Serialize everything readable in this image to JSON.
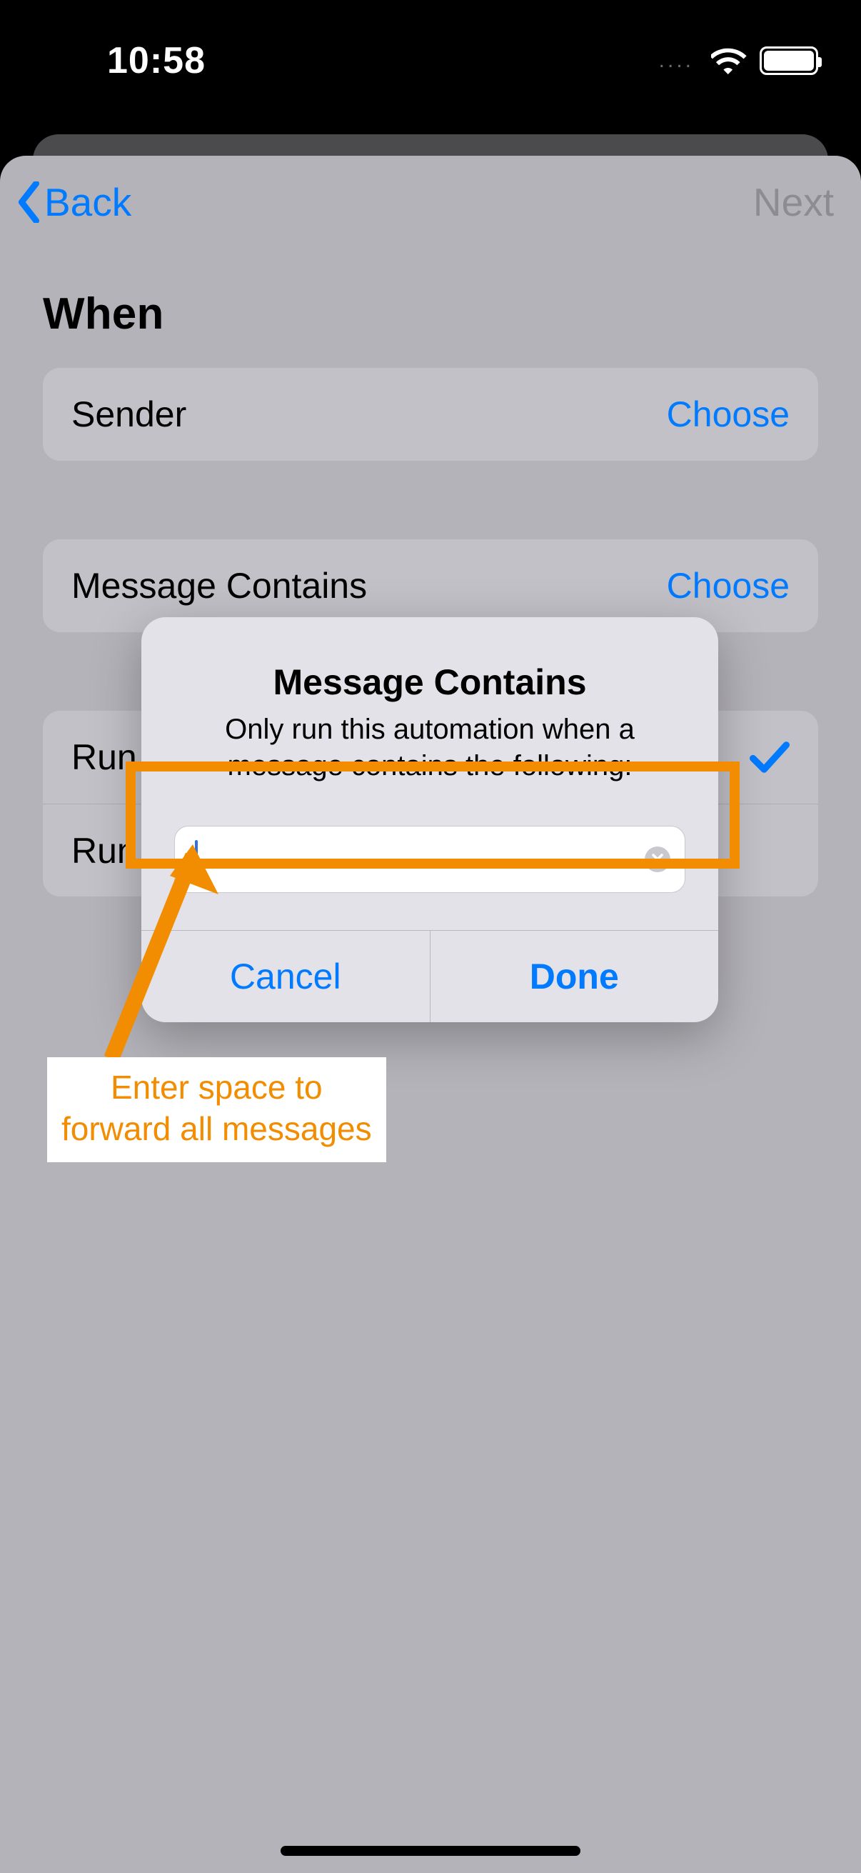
{
  "status": {
    "time": "10:58"
  },
  "nav": {
    "back": "Back",
    "next": "Next"
  },
  "page": {
    "title": "When"
  },
  "rows": {
    "sender": {
      "label": "Sender",
      "action": "Choose"
    },
    "contains": {
      "label": "Message Contains",
      "action": "Choose"
    },
    "confirm": {
      "label": "Run After Confirmation"
    },
    "immediate": {
      "label": "Run Immediately"
    }
  },
  "run_truncated_prefix": "Run",
  "alert": {
    "title": "Message Contains",
    "subtitle": "Only run this automation when a message contains the following:",
    "input_value": "",
    "cancel": "Cancel",
    "done": "Done"
  },
  "annotation": {
    "line1": "Enter space to",
    "line2": "forward all messages"
  }
}
